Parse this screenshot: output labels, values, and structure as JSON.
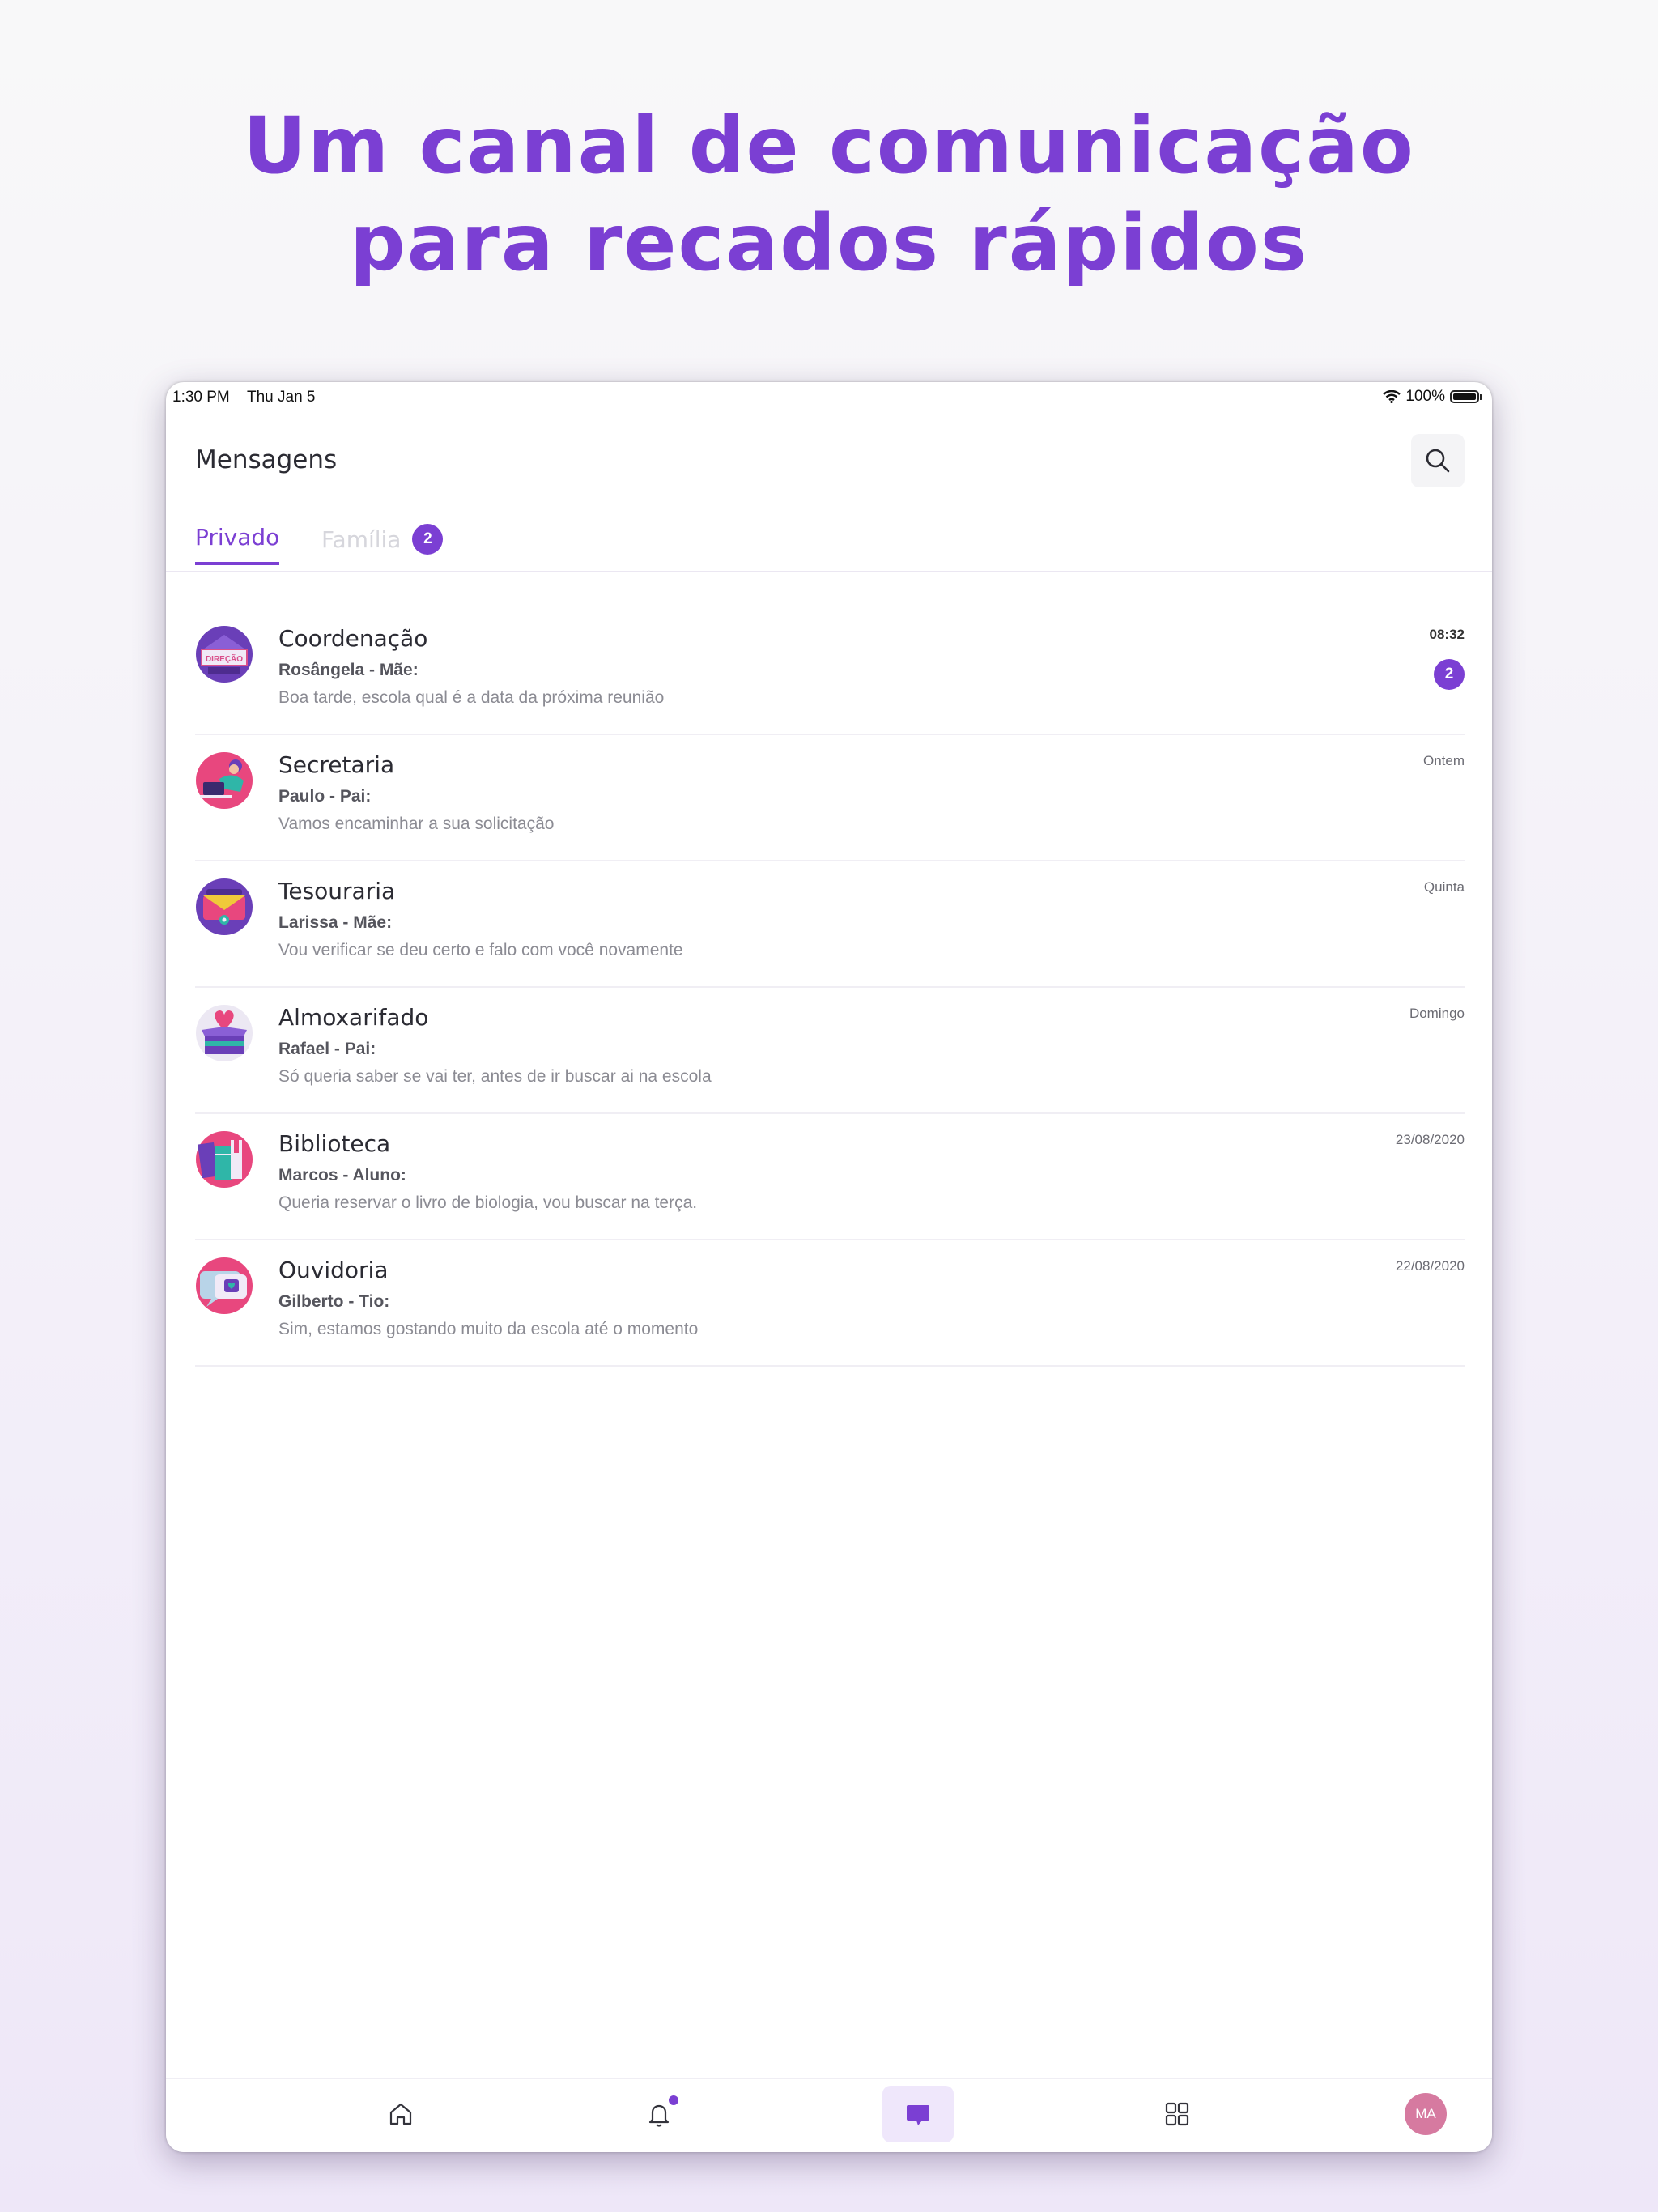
{
  "headline": {
    "line1": "Um canal de comunicação",
    "line2": "para recados rápidos"
  },
  "status_bar": {
    "time": "1:30 PM",
    "date": "Thu Jan 5",
    "battery": "100%"
  },
  "header": {
    "title": "Mensagens",
    "search_icon": "search-icon"
  },
  "tabs": [
    {
      "label": "Privado",
      "active": true
    },
    {
      "label": "Família",
      "active": false,
      "badge": "2"
    }
  ],
  "conversations": [
    {
      "title": "Coordenação",
      "sender": "Rosângela - Mãe:",
      "preview": "Boa tarde, escola qual é a data da próxima reunião",
      "time": "08:32",
      "unread": "2",
      "avatar_text": "DIREÇÃO"
    },
    {
      "title": "Secretaria",
      "sender": "Paulo - Pai:",
      "preview": "Vamos encaminhar a sua solicitação",
      "time": "Ontem"
    },
    {
      "title": "Tesouraria",
      "sender": "Larissa - Mãe:",
      "preview": "Vou verificar se deu certo e falo com você novamente",
      "time": "Quinta"
    },
    {
      "title": "Almoxarifado",
      "sender": "Rafael - Pai:",
      "preview": "Só queria saber se vai ter, antes de ir buscar ai na escola",
      "time": "Domingo"
    },
    {
      "title": "Biblioteca",
      "sender": "Marcos - Aluno:",
      "preview": "Queria reservar o livro de biologia, vou buscar na terça.",
      "time": "23/08/2020"
    },
    {
      "title": "Ouvidoria",
      "sender": "Gilberto - Tio:",
      "preview": "Sim, estamos gostando muito da escola até o momento",
      "time": "22/08/2020"
    }
  ],
  "bottom_nav": {
    "items": [
      "home-icon",
      "bell-icon",
      "chat-icon",
      "grid-icon",
      "profile-avatar"
    ],
    "active": "chat-icon",
    "profile_initials": "MA"
  },
  "colors": {
    "accent": "#7b3fd3",
    "profile": "#d67aa0"
  }
}
